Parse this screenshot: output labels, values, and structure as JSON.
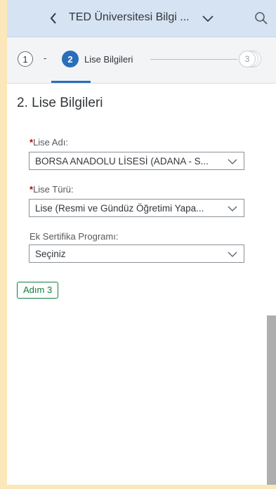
{
  "header": {
    "title": "TED Üniversitesi Bilgi ...",
    "back_icon": "chevron-left-icon",
    "title_menu_icon": "chevron-down-icon",
    "search_icon": "search-icon"
  },
  "wizard": {
    "step1_number": "1",
    "separator": "-",
    "step2_number": "2",
    "step2_label": "Lise Bilgileri",
    "step3_number": "3",
    "active_color": "#2a6ebb"
  },
  "section": {
    "title": "2. Lise Bilgileri"
  },
  "fields": [
    {
      "required_mark": "*",
      "label": "Lise Adı:",
      "value": "BORSA ANADOLU LİSESİ (ADANA - S..."
    },
    {
      "required_mark": "*",
      "label": "Lise Türü:",
      "value": "Lise (Resmi ve Gündüz Öğretimi Yapa..."
    },
    {
      "required_mark": "",
      "label": "Ek Sertifika Programı:",
      "value": "Seçiniz"
    }
  ],
  "actions": {
    "next_step_label": "Adım 3"
  },
  "colors": {
    "background": "#fbe7b9",
    "header": "#d6e3f2",
    "required": "#bb0000",
    "button_accent": "#107e3e"
  }
}
